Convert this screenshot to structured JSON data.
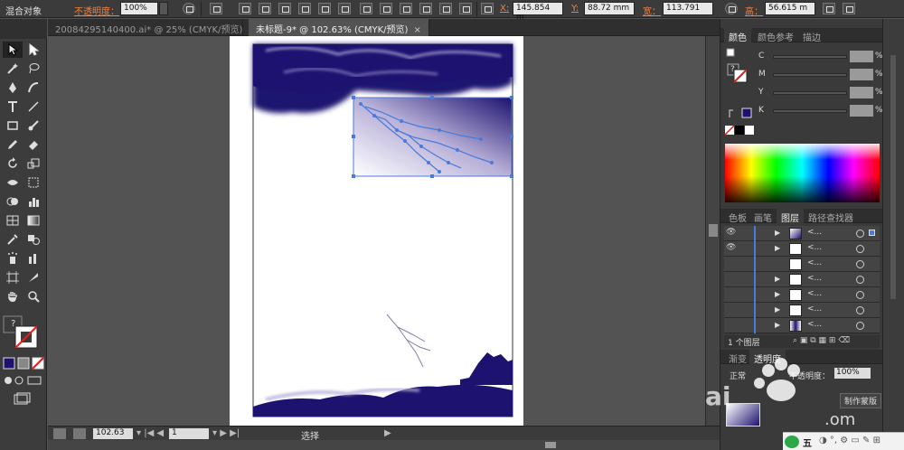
{
  "control_bar": {
    "mixed_objects": "混合对象",
    "opacity_label": "不透明度：",
    "opacity_value": "100%",
    "x_label": "X:",
    "x_value": "145.854 m",
    "y_label": "Y:",
    "y_value": "88.72 mm",
    "w_label": "宽：",
    "w_value": "113.791",
    "h_label": "高：",
    "h_value": "56.615 m"
  },
  "tabs": [
    {
      "label": "20084295140400.ai* @ 25% (CMYK/预览)"
    },
    {
      "label": "未标题-9* @ 102.63% (CMYK/预览)"
    }
  ],
  "tab_close": "×",
  "status": {
    "zoom": "102.63",
    "page": "1",
    "tool": "选择"
  },
  "color_panel": {
    "tabs": [
      "颜色",
      "颜色参考",
      "描边"
    ],
    "channels": [
      "C",
      "M",
      "Y",
      "K"
    ],
    "percent": "%"
  },
  "layers_panel": {
    "tabs": [
      "色板",
      "画笔",
      "图层",
      "路径查找器"
    ],
    "rows": [
      {
        "name": "<..."
      },
      {
        "name": "<..."
      },
      {
        "name": "<..."
      },
      {
        "name": "<..."
      },
      {
        "name": "<..."
      },
      {
        "name": "<..."
      },
      {
        "name": "<..."
      }
    ],
    "footer": "1 个图层"
  },
  "transparency_panel": {
    "tabs": [
      "渐变",
      "透明度"
    ],
    "mode": "正常",
    "opacity_label": "不透明度：",
    "opacity_value": "100%",
    "make_mask_label": "制作蒙版"
  },
  "taskbar": {
    "ime": "五"
  },
  "colors": {
    "navy": "#1d1270",
    "accent_blue": "#4a7bd8",
    "panel_bg": "#3a3a3a",
    "orange": "#f08040"
  }
}
